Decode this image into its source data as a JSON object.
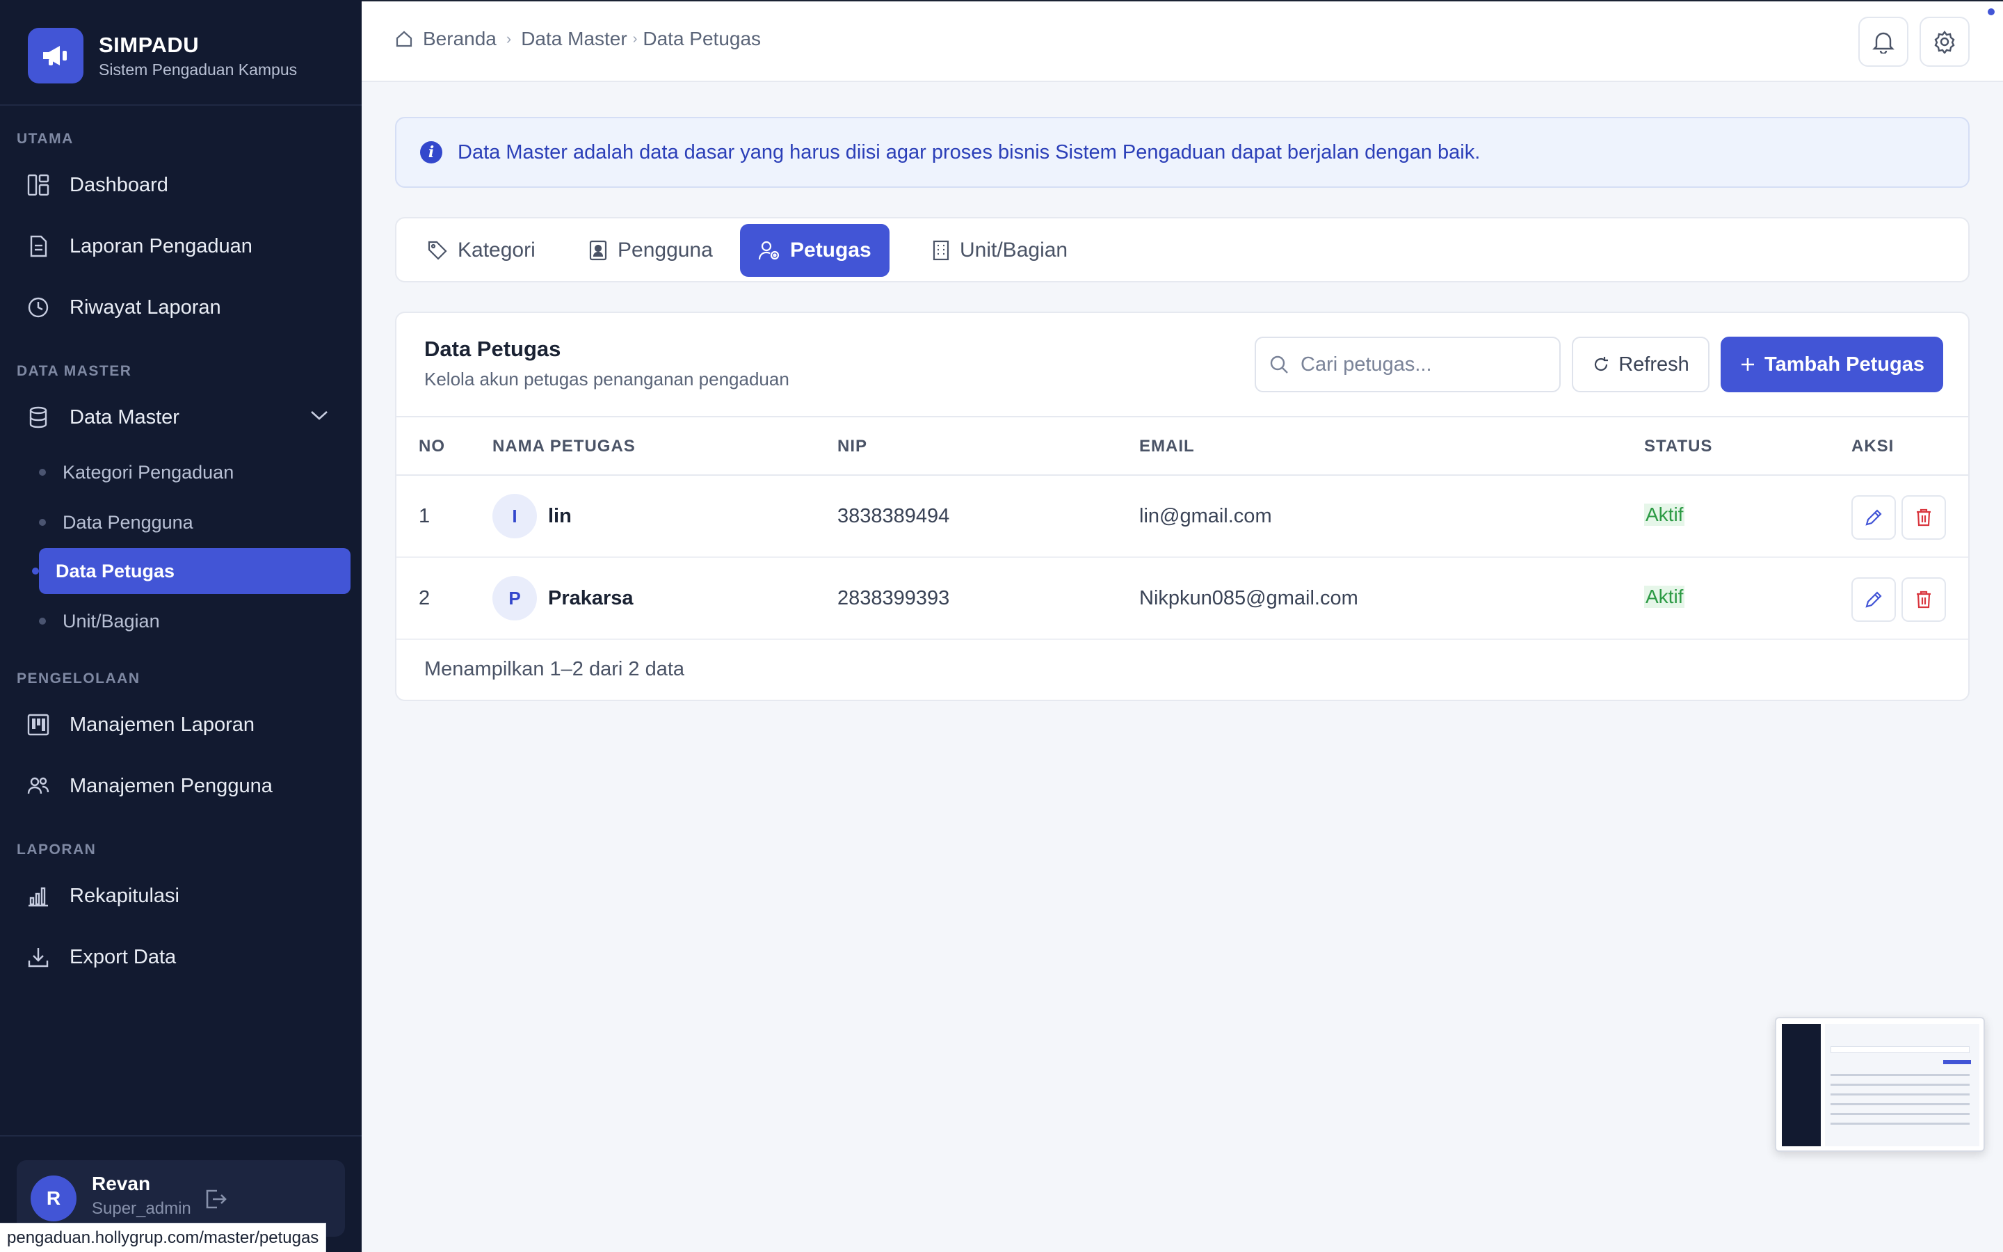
{
  "brand": {
    "title": "SIMPADU",
    "subtitle": "Sistem Pengaduan Kampus"
  },
  "sidebar": {
    "sections": [
      {
        "label": "UTAMA"
      },
      {
        "label": "DATA MASTER"
      },
      {
        "label": "PENGELOLAAN"
      },
      {
        "label": "LAPORAN"
      }
    ],
    "items": [
      {
        "label": "Dashboard",
        "icon": "dashboard-icon"
      },
      {
        "label": "Laporan Pengaduan",
        "icon": "document-icon"
      },
      {
        "label": "Riwayat Laporan",
        "icon": "clock-icon"
      },
      {
        "label": "Data Master",
        "icon": "database-icon",
        "expanded": true
      },
      {
        "label": "Manajemen Laporan",
        "icon": "kanban-icon"
      },
      {
        "label": "Manajemen Pengguna",
        "icon": "users-icon"
      },
      {
        "label": "Rekapitulasi",
        "icon": "bar-chart-icon"
      },
      {
        "label": "Export Data",
        "icon": "download-icon"
      }
    ],
    "sub_items": [
      {
        "label": "Kategori Pengaduan",
        "active": false
      },
      {
        "label": "Data Pengguna",
        "active": false
      },
      {
        "label": "Data Petugas",
        "active": true
      },
      {
        "label": "Unit/Bagian",
        "active": false
      }
    ],
    "user": {
      "initial": "R",
      "name": "Revan",
      "role": "Super_admin"
    }
  },
  "breadcrumb": {
    "home": "Beranda",
    "parent": "Data Master",
    "current": "Data Petugas"
  },
  "info_banner": "Data Master adalah data dasar yang harus diisi agar proses bisnis Sistem Pengaduan dapat berjalan dengan baik.",
  "tabs": [
    {
      "label": "Kategori",
      "icon": "tag-icon",
      "active": false
    },
    {
      "label": "Pengguna",
      "icon": "id-badge-icon",
      "active": false
    },
    {
      "label": "Petugas",
      "icon": "user-gear-icon",
      "active": true
    },
    {
      "label": "Unit/Bagian",
      "icon": "building-icon",
      "active": false
    }
  ],
  "card": {
    "title": "Data Petugas",
    "subtitle": "Kelola akun petugas penanganan pengaduan",
    "search_placeholder": "Cari petugas...",
    "refresh_label": "Refresh",
    "add_label": "Tambah Petugas"
  },
  "table": {
    "headers": [
      "NO",
      "NAMA PETUGAS",
      "NIP",
      "EMAIL",
      "STATUS",
      "AKSI"
    ],
    "rows": [
      {
        "no": "1",
        "initial": "I",
        "name": "lin",
        "nip": "3838389494",
        "email": "lin@gmail.com",
        "status": "Aktif"
      },
      {
        "no": "2",
        "initial": "P",
        "name": "Prakarsa",
        "nip": "2838399393",
        "email": "Nikpkun085@gmail.com",
        "status": "Aktif"
      }
    ],
    "footer": "Menampilkan 1–2 dari 2 data"
  },
  "status_url": "pengaduan.hollygrup.com/master/petugas",
  "colors": {
    "accent": "#4255d6",
    "sidebar_bg": "#121a30",
    "status_active": "#2c9a44",
    "danger": "#d9363e"
  }
}
